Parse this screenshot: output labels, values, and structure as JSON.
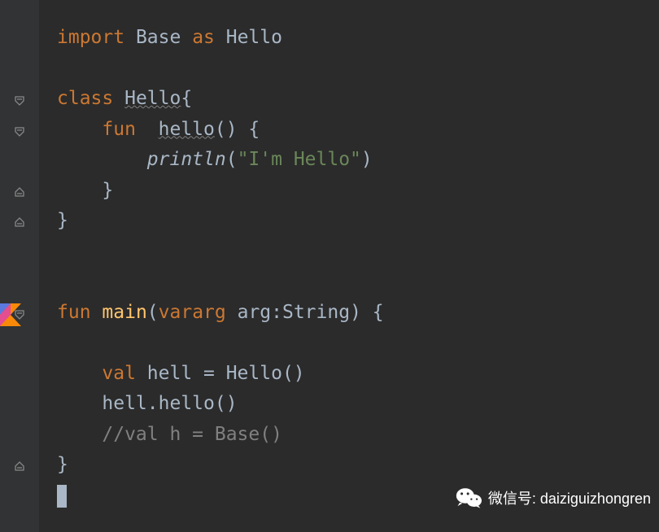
{
  "code": {
    "line1_import": "import",
    "line1_base": " Base ",
    "line1_as": "as",
    "line1_hello": " Hello",
    "line3_class": "class",
    "line3_hello": "Hello",
    "line3_brace": "{",
    "line4_fun": "fun",
    "line4_hello": "hello",
    "line4_parens": "() {",
    "line5_println": "println",
    "line5_open": "(",
    "line5_string": "\"I'm Hello\"",
    "line5_close": ")",
    "line6_brace": "    }",
    "line7_brace": "}",
    "line10_fun": "fun",
    "line10_main": "main",
    "line10_open": "(",
    "line10_vararg": "vararg",
    "line10_arg": " arg:String) {",
    "line12_val": "val",
    "line12_hell": " hell = Hello()",
    "line13": "    hell.hello()",
    "line14_comment": "    //val h = Base()",
    "line15_brace": "}",
    "indent4": "    ",
    "indent8": "        ",
    "space": " ",
    "space2": "  "
  },
  "watermark": {
    "label": "微信号: daiziguizhongren"
  }
}
